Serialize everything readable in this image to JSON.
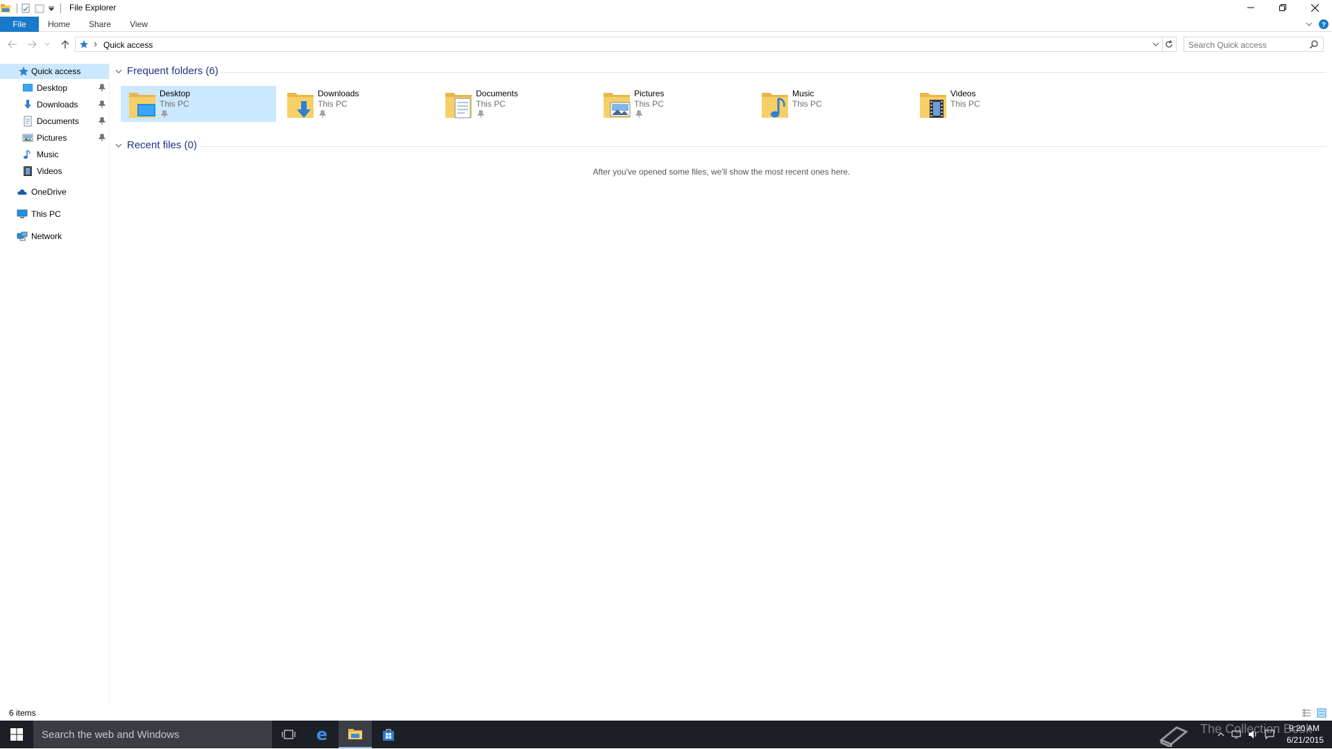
{
  "window": {
    "title": "File Explorer",
    "tabs": [
      "File",
      "Home",
      "Share",
      "View"
    ]
  },
  "address": {
    "path": "Quick access",
    "search_placeholder": "Search Quick access"
  },
  "navpane": {
    "items": [
      {
        "label": "Quick access",
        "icon": "star-icon",
        "pinned": false
      },
      {
        "label": "Desktop",
        "icon": "desktop-icon",
        "pinned": true
      },
      {
        "label": "Downloads",
        "icon": "download-icon",
        "pinned": true
      },
      {
        "label": "Documents",
        "icon": "document-icon",
        "pinned": true
      },
      {
        "label": "Pictures",
        "icon": "picture-icon",
        "pinned": true
      },
      {
        "label": "Music",
        "icon": "music-icon",
        "pinned": false
      },
      {
        "label": "Videos",
        "icon": "video-icon",
        "pinned": false
      },
      {
        "label": "OneDrive",
        "icon": "cloud-icon",
        "pinned": false
      },
      {
        "label": "This PC",
        "icon": "computer-icon",
        "pinned": false
      },
      {
        "label": "Network",
        "icon": "network-icon",
        "pinned": false
      }
    ]
  },
  "content": {
    "frequent_title": "Frequent folders (6)",
    "recent_title": "Recent files (0)",
    "recent_empty": "After you've opened some files, we'll show the most recent ones here.",
    "folders": [
      {
        "name": "Desktop",
        "location": "This PC",
        "pinned": true,
        "icon": "desktop-folder-icon"
      },
      {
        "name": "Downloads",
        "location": "This PC",
        "pinned": true,
        "icon": "downloads-folder-icon"
      },
      {
        "name": "Documents",
        "location": "This PC",
        "pinned": true,
        "icon": "documents-folder-icon"
      },
      {
        "name": "Pictures",
        "location": "This PC",
        "pinned": true,
        "icon": "pictures-folder-icon"
      },
      {
        "name": "Music",
        "location": "This PC",
        "pinned": false,
        "icon": "music-folder-icon"
      },
      {
        "name": "Videos",
        "location": "This PC",
        "pinned": false,
        "icon": "videos-folder-icon"
      }
    ]
  },
  "status": {
    "items_count": "6 items"
  },
  "taskbar": {
    "search_text": "Search the web and Windows",
    "time": "9:20 AM",
    "date": "6/21/2015",
    "watermark": "The Collection Book"
  },
  "colors": {
    "accent": "#1979ca",
    "selection": "#cce8ff",
    "section_heading": "#1e3287",
    "taskbar": "#1c1f26"
  }
}
